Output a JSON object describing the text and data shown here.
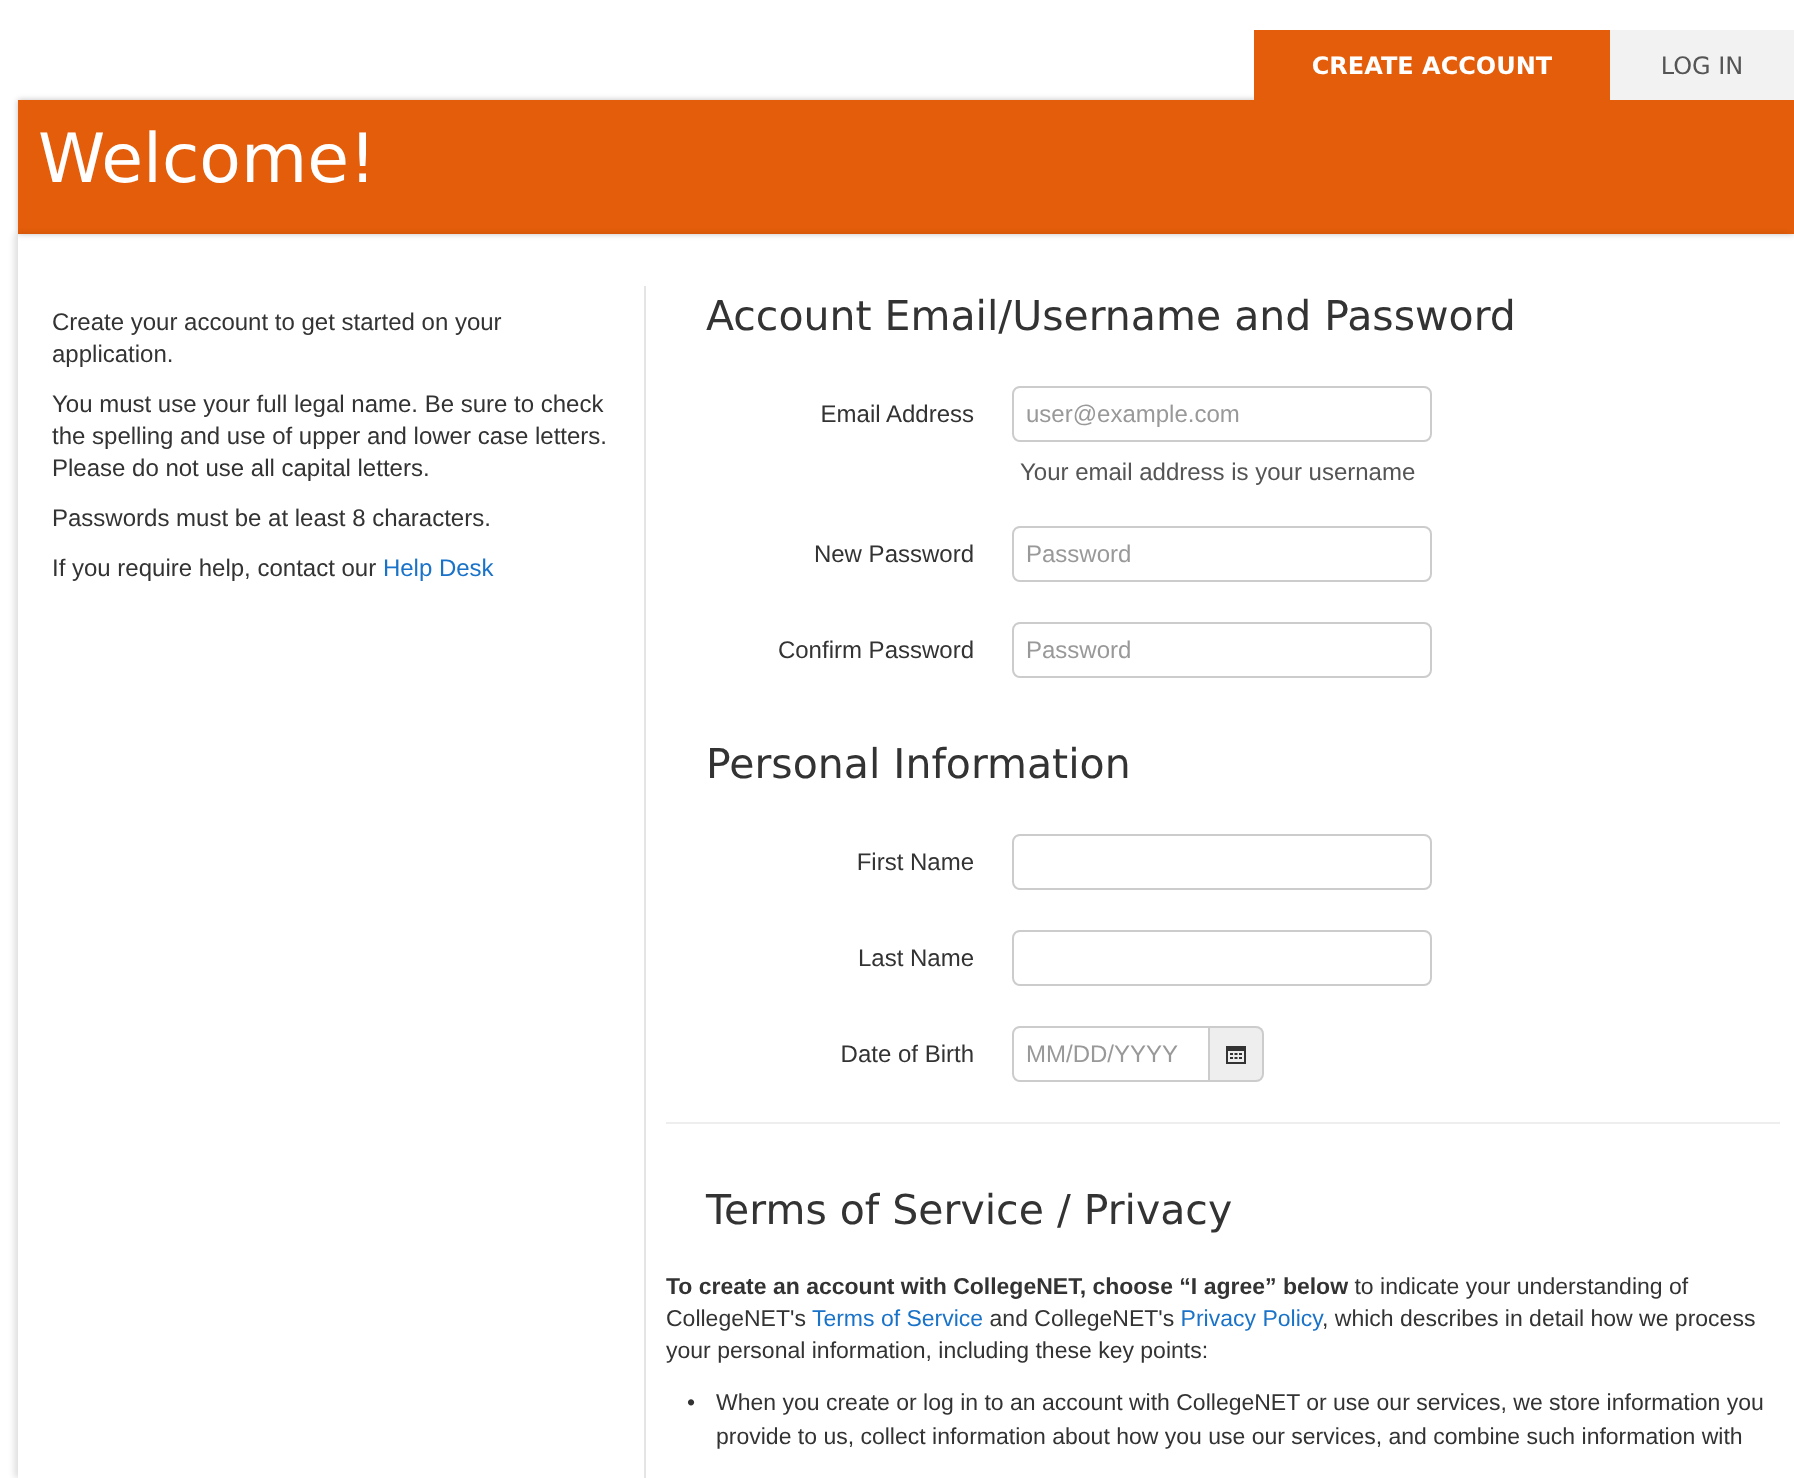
{
  "tabs": [
    {
      "label": "CREATE ACCOUNT",
      "selected": true
    },
    {
      "label": "LOG IN",
      "selected": false
    }
  ],
  "header": {
    "title": "Welcome!"
  },
  "sidebar": {
    "paragraphs": [
      [
        {
          "kind": "text",
          "text": "Create your account to get started on your application."
        }
      ],
      [
        {
          "kind": "text",
          "text": "You must use your full legal name. Be sure to check the spelling and use of upper and lower case letters. Please do not use all capital letters."
        }
      ],
      [
        {
          "kind": "text",
          "text": "Passwords must be at least 8 characters."
        }
      ],
      [
        {
          "kind": "text",
          "text": "If you require help, contact our "
        },
        {
          "kind": "link",
          "text": "Help Desk"
        }
      ]
    ]
  },
  "sections": [
    {
      "title": "Account Email/Username and Password",
      "fields": [
        {
          "kind": "text",
          "label": "Email Address",
          "placeholder": "user@example.com",
          "help": "Your email address is your username"
        },
        {
          "kind": "password",
          "label": "New Password",
          "placeholder": "Password"
        },
        {
          "kind": "password",
          "label": "Confirm Password",
          "placeholder": "Password"
        }
      ]
    },
    {
      "title": "Personal Information",
      "fields": [
        {
          "kind": "text",
          "label": "First Name"
        },
        {
          "kind": "text",
          "label": "Last Name"
        },
        {
          "kind": "date",
          "label": "Date of Birth",
          "placeholder": "MM/DD/YYYY"
        }
      ]
    }
  ],
  "terms": {
    "title": "Terms of Service / Privacy",
    "paragraph": [
      {
        "kind": "bold",
        "text": "To create an account with CollegeNET, choose “I agree” below"
      },
      {
        "kind": "text",
        "text": " to indicate your understanding of CollegeNET's "
      },
      {
        "kind": "link",
        "text": "Terms of Service"
      },
      {
        "kind": "text",
        "text": " and CollegeNET's "
      },
      {
        "kind": "link",
        "text": "Privacy Policy"
      },
      {
        "kind": "text",
        "text": ", which describes in detail how we process your personal information, including these key points:"
      }
    ],
    "bullets": [
      {
        "marker": "•",
        "text": "When you create or log in to an account with CollegeNET or use our services, we store information you provide to us, collect information about how you use our services, and combine such information with"
      }
    ]
  }
}
